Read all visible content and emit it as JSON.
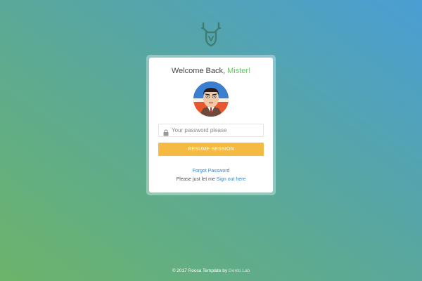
{
  "card": {
    "welcome_text": "Welcome Back, ",
    "user_name": "Mister!",
    "password_placeholder": "Your password please",
    "resume_label": "RESUME SESSION",
    "forgot_label": "Forgot Password",
    "signout_prefix": "Please just let me ",
    "signout_label": "Sign out here"
  },
  "footer": {
    "copyright": "© 2017 Roosa Template by ",
    "company": "Gento Lab"
  },
  "colors": {
    "accent_green": "#6cbf6a",
    "button": "#f5ba42",
    "link": "#3d82c9"
  },
  "icons": {
    "logo": "deer-antler-logo-icon",
    "lock": "lock-icon"
  }
}
